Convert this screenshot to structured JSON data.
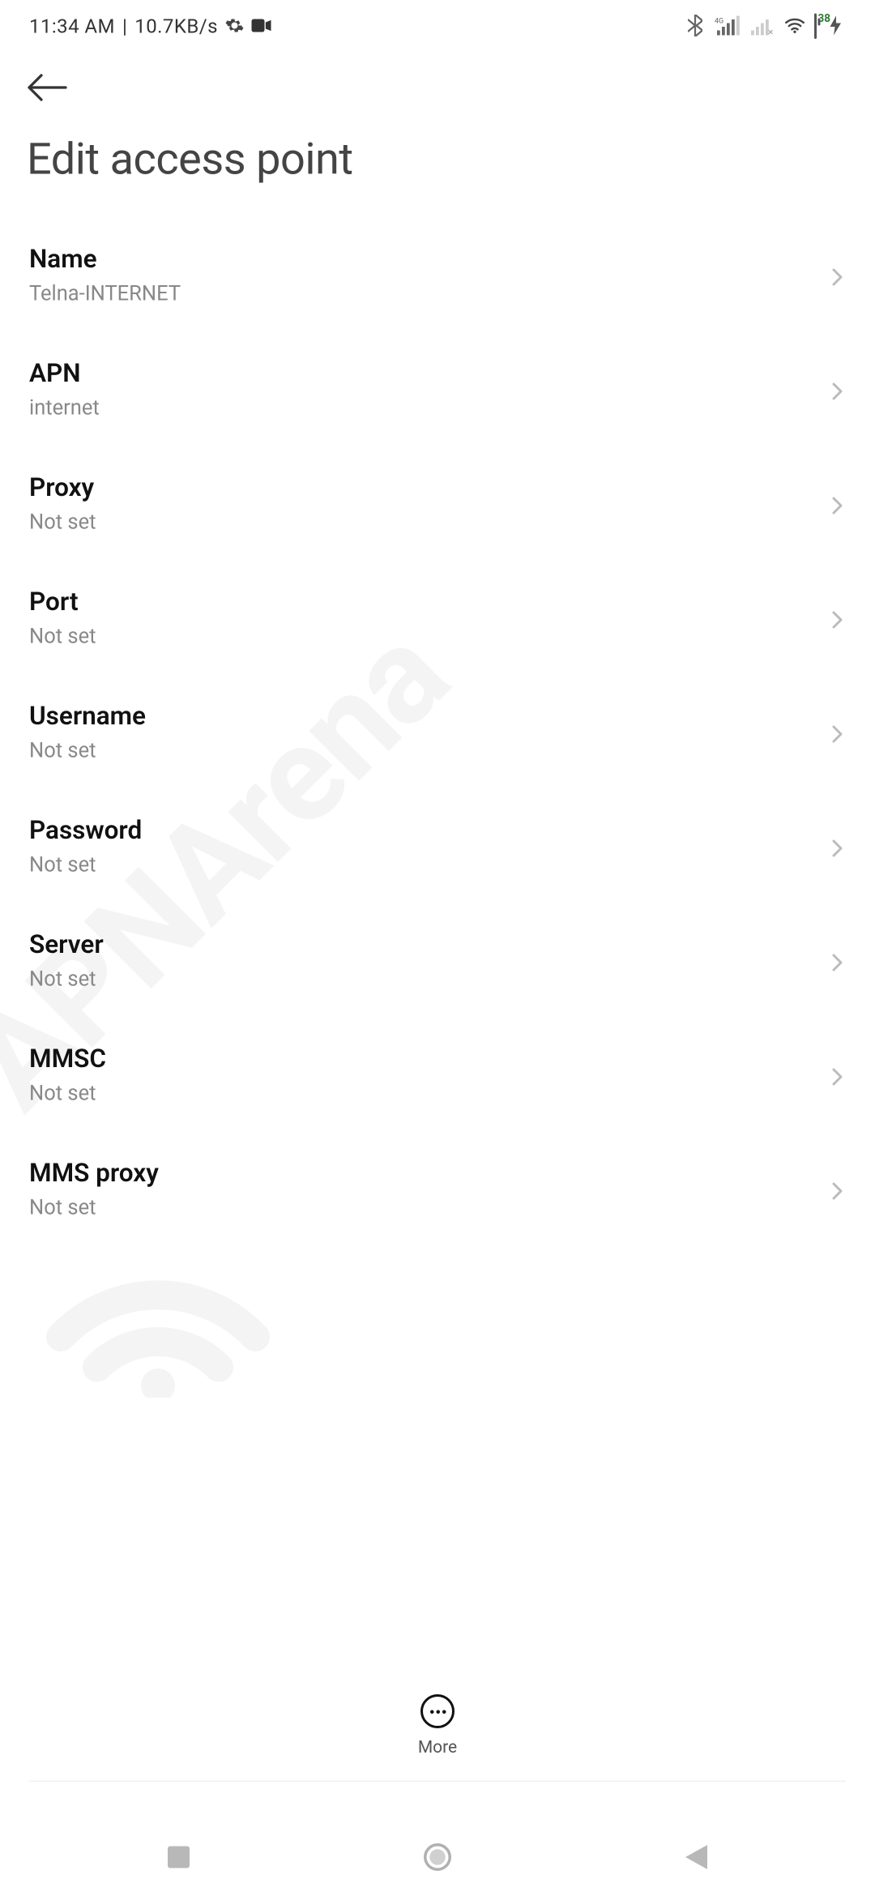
{
  "status": {
    "time": "11:34 AM",
    "speed": "10.7KB/s",
    "battery": "38"
  },
  "header": {
    "title": "Edit access point"
  },
  "items": [
    {
      "label": "Name",
      "value": "Telna-INTERNET"
    },
    {
      "label": "APN",
      "value": "internet"
    },
    {
      "label": "Proxy",
      "value": "Not set"
    },
    {
      "label": "Port",
      "value": "Not set"
    },
    {
      "label": "Username",
      "value": "Not set"
    },
    {
      "label": "Password",
      "value": "Not set"
    },
    {
      "label": "Server",
      "value": "Not set"
    },
    {
      "label": "MMSC",
      "value": "Not set"
    },
    {
      "label": "MMS proxy",
      "value": "Not set"
    }
  ],
  "more_label": "More",
  "watermark": "APNArena"
}
